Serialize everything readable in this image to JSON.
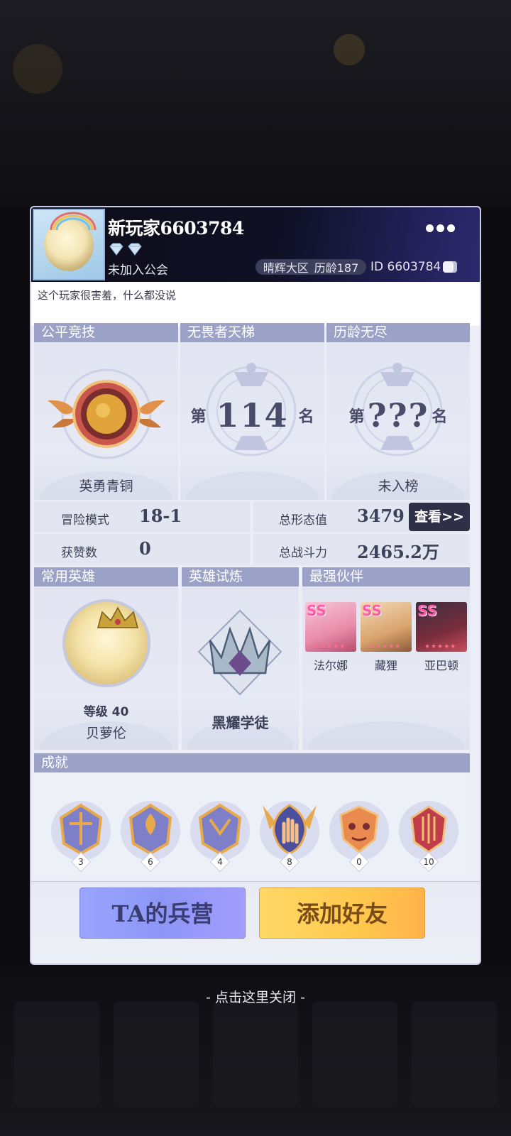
{
  "header": {
    "player_name": "新玩家6603784",
    "guild": "未加入公会",
    "server": "晴辉大区",
    "age": "历龄187",
    "player_id": "ID 6603784"
  },
  "bio": "这个玩家很害羞，什么都没说",
  "ranked": {
    "fair_title": "公平竞技",
    "fair_rank": "英勇青铜",
    "ladder_title": "无畏者天梯",
    "ladder_prefix": "第",
    "ladder_rank": "114",
    "ladder_suffix": "名",
    "endless_title": "历龄无尽",
    "endless_prefix": "第",
    "endless_rank": "???",
    "endless_suffix": "名",
    "endless_label": "未入榜"
  },
  "stats": {
    "adventure_label": "冒险模式",
    "adventure_value": "18-1",
    "likes_label": "获赞数",
    "likes_value": "0",
    "form_label": "总形态值",
    "form_value": "3479",
    "power_label": "总战斗力",
    "power_value": "2465.2万",
    "view_button": "查看>>"
  },
  "heroes": {
    "common_title": "常用英雄",
    "hero_level": "等级 40",
    "hero_name": "贝萝伦",
    "trial_title": "英雄试炼",
    "trial_rank": "黑耀学徒",
    "partners_title": "最强伙伴",
    "partners": [
      {
        "badge": "SS",
        "name": "法尔娜"
      },
      {
        "badge": "SS",
        "name": "藏狸"
      },
      {
        "badge": "SS",
        "name": "亚巴顿"
      }
    ]
  },
  "achievements": {
    "title": "成就",
    "items": [
      {
        "icon": "achievement-badge-1",
        "count": "3"
      },
      {
        "icon": "achievement-badge-2",
        "count": "6"
      },
      {
        "icon": "achievement-badge-3",
        "count": "4"
      },
      {
        "icon": "achievement-badge-hand",
        "count": "8"
      },
      {
        "icon": "achievement-badge-mask",
        "count": "0"
      },
      {
        "icon": "achievement-badge-ruby",
        "count": "10"
      }
    ]
  },
  "buttons": {
    "barracks": "TA的兵营",
    "add_friend": "添加好友"
  },
  "close_hint": "- 点击这里关闭 -",
  "colors": {
    "header_bg": "#0f1024",
    "section_header": "#9ca1c7",
    "barracks_btn": "#9aa5ff",
    "add_friend_btn": "#ffc84d"
  }
}
